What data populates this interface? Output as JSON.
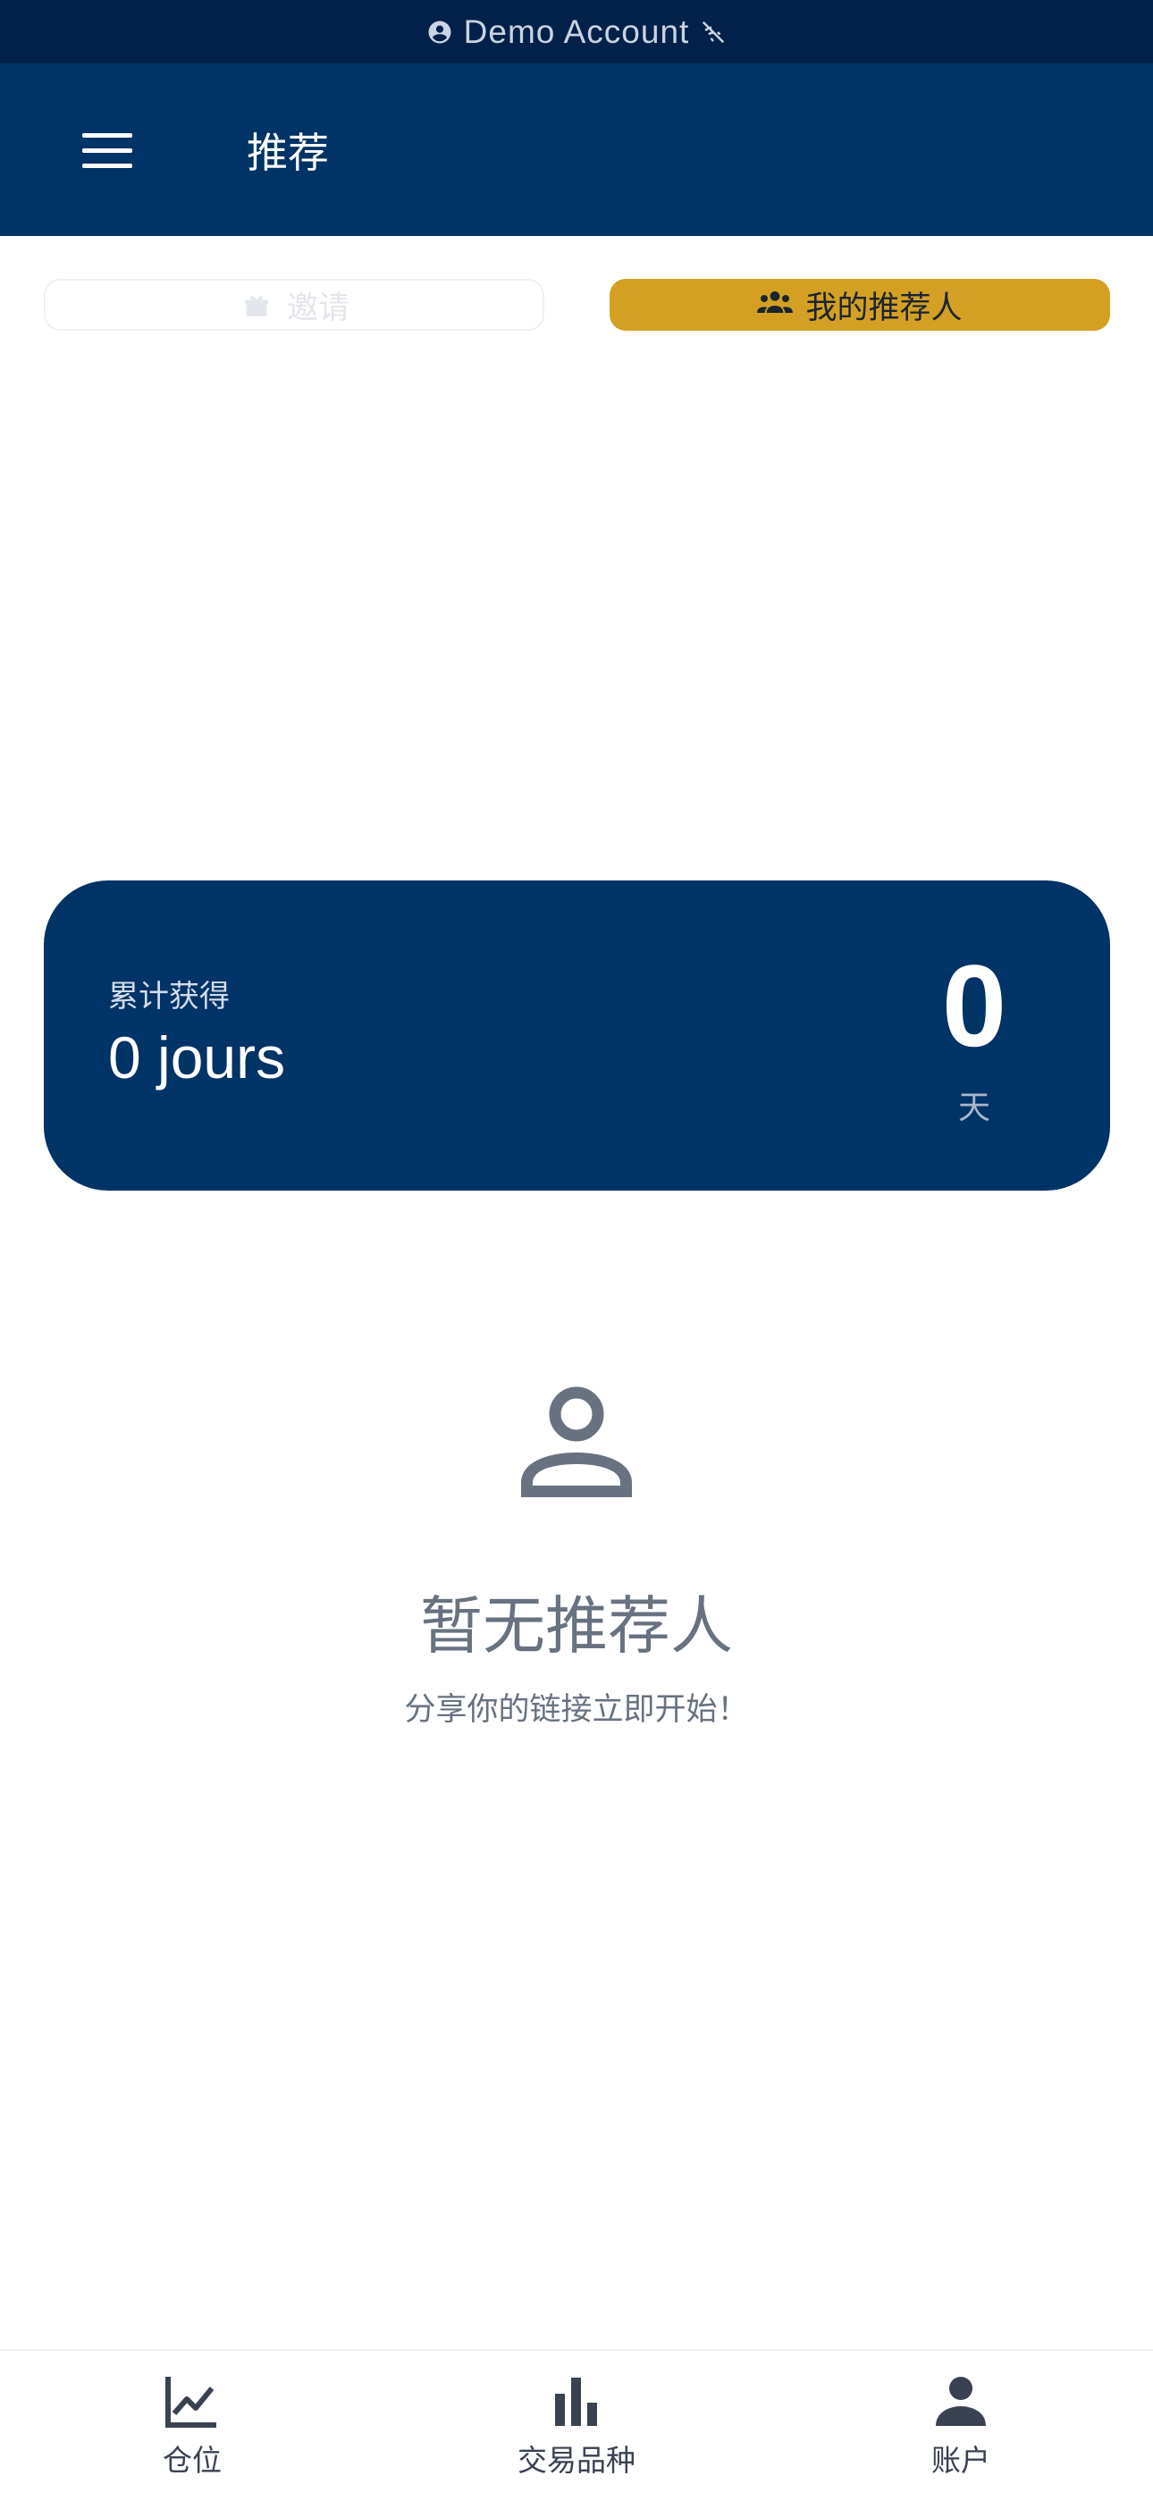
{
  "status_bar": {
    "text": "Demo Account",
    "icons": [
      "account-circle-icon",
      "wifi-off-icon"
    ]
  },
  "header": {
    "title": "推荐",
    "menu_icon": "hamburger-menu-icon"
  },
  "tabs": [
    {
      "label": "邀请",
      "icon": "gift-icon",
      "active": false
    },
    {
      "label": "我的推荐人",
      "icon": "group-icon",
      "active": true
    }
  ],
  "summary": {
    "label": "累计获得",
    "value": "0 jours",
    "number": "0",
    "unit": "天"
  },
  "empty_state": {
    "icon": "person-outline-icon",
    "title": "暂无推荐人",
    "subtitle": "分享你的链接立即开始！"
  },
  "bottom_nav": [
    {
      "label": "仓位",
      "icon": "line-chart-icon"
    },
    {
      "label": "交易品种",
      "icon": "bar-chart-icon"
    },
    {
      "label": "账户",
      "icon": "person-icon"
    }
  ],
  "colors": {
    "status_bar_bg": "#01214a",
    "primary": "#003366",
    "accent": "#d4a023",
    "muted_text": "#687280"
  }
}
